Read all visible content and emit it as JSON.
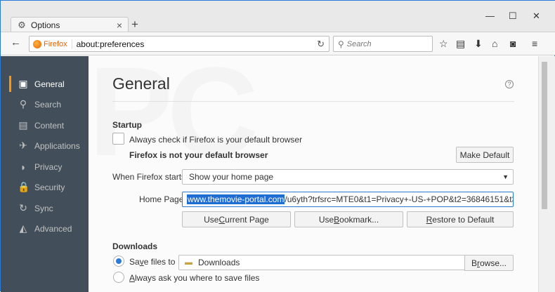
{
  "window": {
    "tab_title": "Options",
    "new_tab_symbol": "+",
    "controls": {
      "minimize": "—",
      "maximize": "☐",
      "close": "✕"
    }
  },
  "navbar": {
    "identity_label": "Firefox",
    "url": "about:preferences",
    "search_placeholder": "Search"
  },
  "sidebar": {
    "items": [
      {
        "label": "General",
        "icon": "general-icon",
        "glyph": "▣",
        "active": true
      },
      {
        "label": "Search",
        "icon": "search-icon",
        "glyph": "⚲",
        "active": false
      },
      {
        "label": "Content",
        "icon": "content-icon",
        "glyph": "▤",
        "active": false
      },
      {
        "label": "Applications",
        "icon": "applications-icon",
        "glyph": "✈",
        "active": false
      },
      {
        "label": "Privacy",
        "icon": "privacy-mask-icon",
        "glyph": "◗",
        "active": false
      },
      {
        "label": "Security",
        "icon": "lock-icon",
        "glyph": "🔒",
        "active": false
      },
      {
        "label": "Sync",
        "icon": "sync-icon",
        "glyph": "↻",
        "active": false
      },
      {
        "label": "Advanced",
        "icon": "advanced-wizard-icon",
        "glyph": "◭",
        "active": false
      }
    ]
  },
  "main": {
    "title": "General",
    "help_symbol": "?",
    "startup": {
      "heading": "Startup",
      "default_check_label": "Always check if Firefox is your default browser",
      "not_default_text": "Firefox is not your default browser",
      "make_default_button": "Make Default",
      "when_starts_label": "When Firefox starts:",
      "when_starts_value": "Show your home page",
      "home_page_label": "Home Page:",
      "home_page_selected": "www.themovie-portal.com",
      "home_page_rest": "/u6yth?trfsrc=MTE0&t1=Privacy+-US-+POP&t2=36846151&t3=&t",
      "use_current_prefix": "Use ",
      "use_current_underlined": "C",
      "use_current_suffix": "urrent Page",
      "use_bookmark_prefix": "Use ",
      "use_bookmark_underlined": "B",
      "use_bookmark_suffix": "ookmark...",
      "restore_prefix": "",
      "restore_underlined": "R",
      "restore_suffix": "estore to Default"
    },
    "downloads": {
      "heading": "Downloads",
      "save_files_prefix": "Sa",
      "save_files_underlined": "v",
      "save_files_suffix": "e files to",
      "folder": "Downloads",
      "browse_prefix": "B",
      "browse_underlined": "r",
      "browse_suffix": "owse...",
      "always_ask_prefix": "",
      "always_ask_underlined": "A",
      "always_ask_suffix": "lways ask you where to save files"
    }
  },
  "colors": {
    "accent": "#2a7ad6",
    "sidebar_bg": "#424f5a",
    "active_marker": "#ff9500"
  }
}
